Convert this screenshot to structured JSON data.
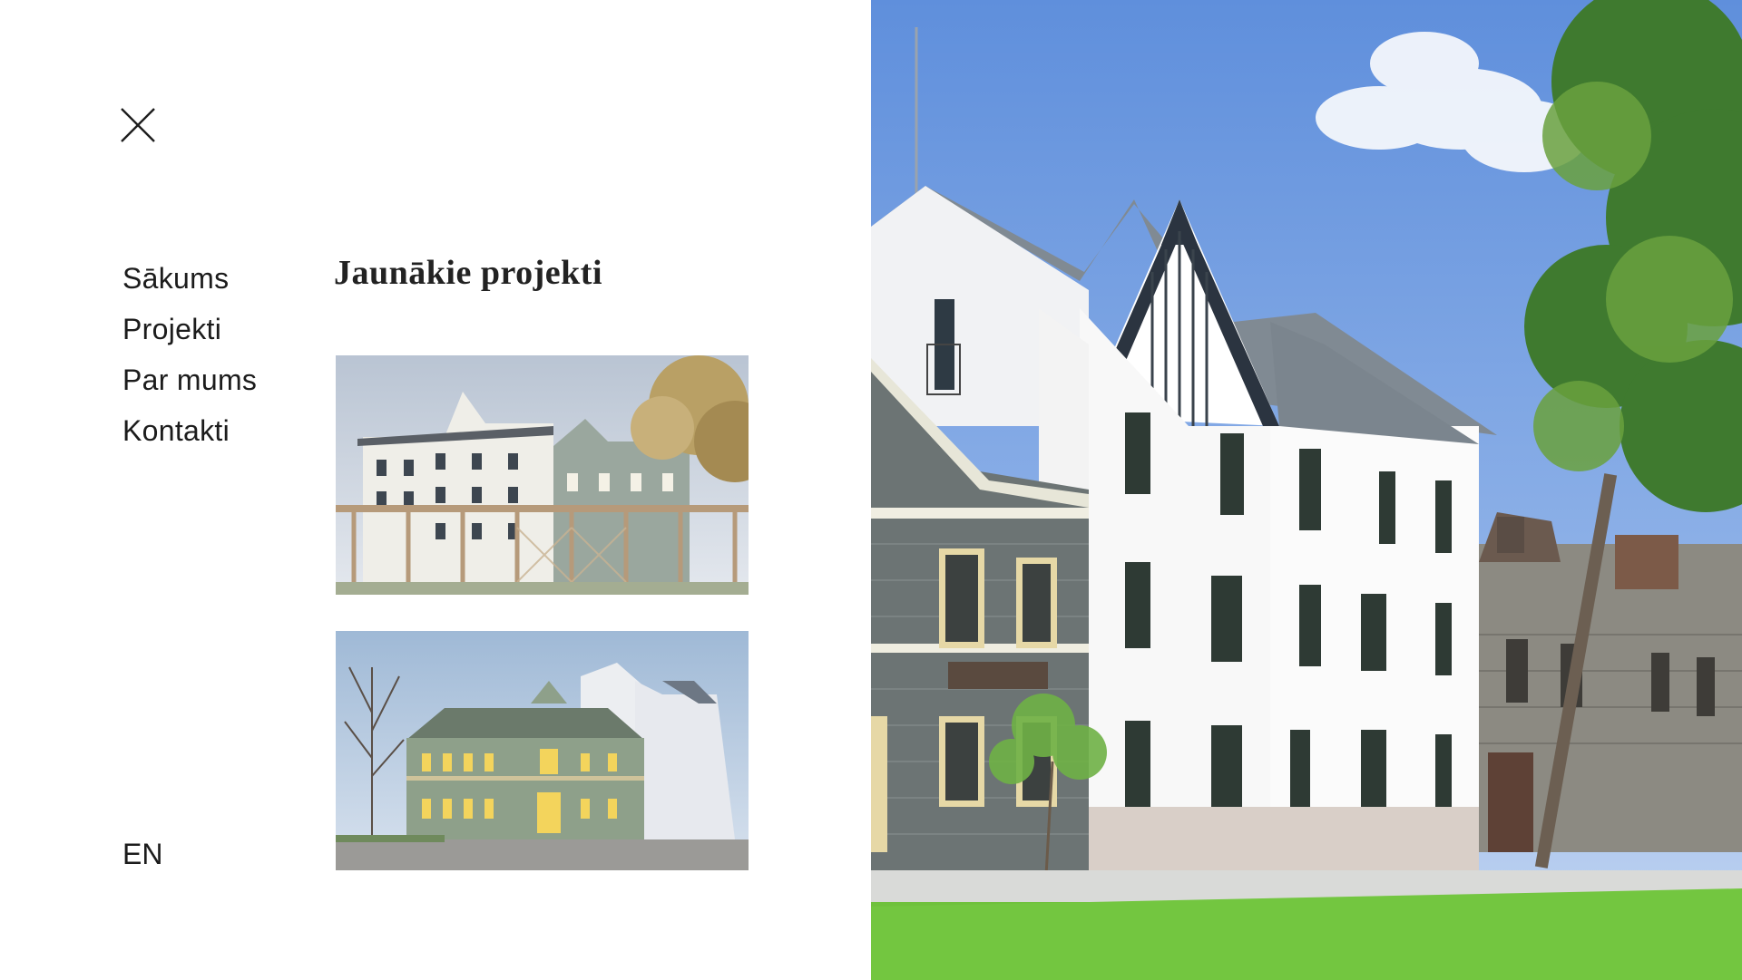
{
  "menu": {
    "close_icon": "close-icon",
    "nav_items": [
      {
        "label": "Sākums"
      },
      {
        "label": "Projekti"
      },
      {
        "label": "Par mums"
      },
      {
        "label": "Kontakti"
      }
    ],
    "language": "EN"
  },
  "latest_projects": {
    "title": "Jaunākie projekti",
    "items": [
      {
        "image": "project-photo-white-grey-buildings-with-pergola"
      },
      {
        "image": "project-photo-green-wooden-corner-house"
      }
    ]
  },
  "hero": {
    "image": "hero-photo-white-apartment-building-street"
  },
  "colors": {
    "background": "#ffffff",
    "text": "#1c1c1c"
  }
}
